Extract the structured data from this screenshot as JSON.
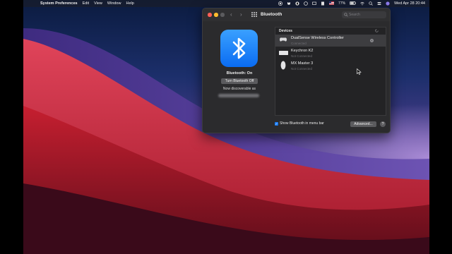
{
  "menubar": {
    "apple_glyph": "",
    "items": [
      "System Preferences",
      "Edit",
      "View",
      "Window",
      "Help"
    ],
    "battery": "77%",
    "clock": "Wed Apr 28  20:44"
  },
  "window": {
    "title": "Bluetooth",
    "search_placeholder": "Search"
  },
  "bluetooth": {
    "status": "Bluetooth: On",
    "toggle_label": "Turn Bluetooth Off",
    "discoverable": "Now discoverable as"
  },
  "devices": {
    "header": "Devices",
    "list": [
      {
        "name": "DualSense Wireless Controller",
        "status": "Connected",
        "icon": "gamepad-icon",
        "selected": true
      },
      {
        "name": "Keychron K2",
        "status": "Not Connected",
        "icon": "keyboard-icon",
        "selected": false
      },
      {
        "name": "MX Master 3",
        "status": "Not Connected",
        "icon": "mouse-icon",
        "selected": false
      }
    ],
    "remove_glyph": "×"
  },
  "footer": {
    "show_in_menu_bar": "Show Bluetooth in menu bar",
    "show_checked": true,
    "check_glyph": "✓",
    "advanced_label": "Advanced...",
    "help_label": "?"
  },
  "colors": {
    "accent": "#0a6cf2",
    "close": "#ff5f57",
    "minimize": "#ffbd2e",
    "zoom": "#5b5b5e"
  }
}
